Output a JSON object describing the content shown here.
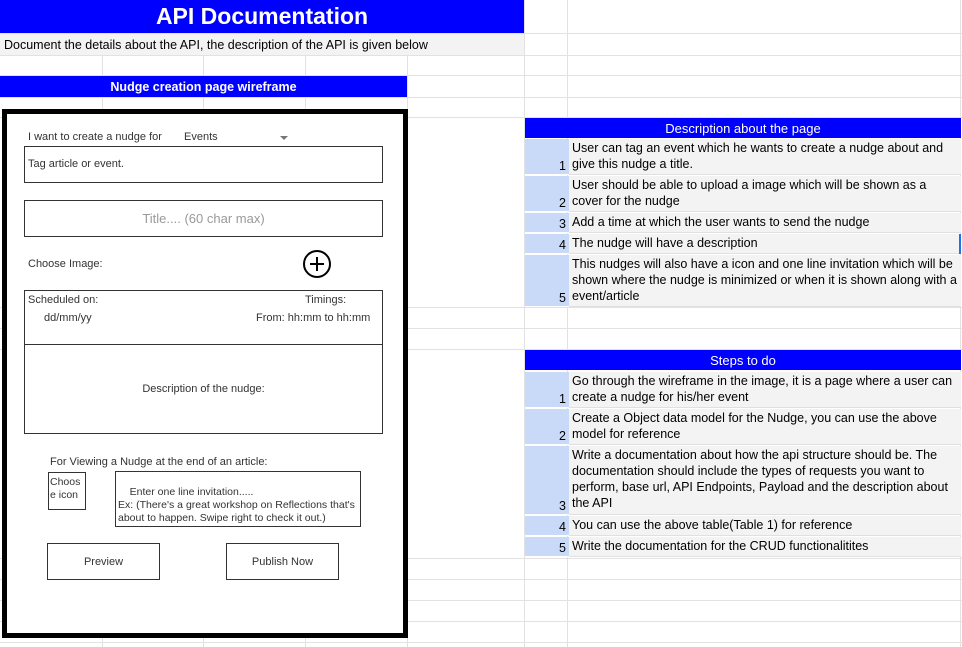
{
  "title": "API Documentation",
  "subtitle": "Document the details about the API, the description of the API is given below",
  "wireframe": {
    "header": "Nudge creation page wireframe",
    "create_label": "I want to create a nudge for",
    "select_value": "Events",
    "tag_placeholder": "Tag article or event.",
    "title_placeholder": "Title.... (60 char max)",
    "choose_image_label": "Choose Image:",
    "scheduled_label": "Scheduled on:",
    "date_placeholder": "dd/mm/yy",
    "timings_label": "Timings:",
    "time_range": "From: hh:mm to hh:mm",
    "description_label": "Description of the nudge:",
    "viewing_label": "For Viewing a Nudge at the end of an article:",
    "choose_icon_label": "Choos e icon",
    "invitation_text": "Enter one line invitation.....\nEx: (There's a great workshop on Reflections that's about to happen. Swipe right to check it out.)",
    "preview_button": "Preview",
    "publish_button": "Publish Now"
  },
  "description_table": {
    "header": "Description about the page",
    "rows": [
      {
        "num": "1",
        "text": "User can tag an event which he wants to create a nudge about and give this nudge a title."
      },
      {
        "num": "2",
        "text": "User should be able to upload a image which will be shown as a cover for the nudge"
      },
      {
        "num": "3",
        "text": "Add a time at which the user wants to send the nudge"
      },
      {
        "num": "4",
        "text": "The nudge will have a description"
      },
      {
        "num": "5",
        "text": "This nudges will also have a icon and one line invitation which will be shown where the nudge is minimized or when it is shown along with a event/article"
      }
    ]
  },
  "steps_table": {
    "header": "Steps to do",
    "rows": [
      {
        "num": "1",
        "text": "Go through the wireframe in the image, it is a page where a user can create a nudge for his/her event"
      },
      {
        "num": "2",
        "text": "Create a Object data model for the Nudge, you can use the above model for reference"
      },
      {
        "num": "3",
        "text": "Write a documentation about how the api structure should be. The documentation should include the types of requests you want to perform, base url, API Endpoints, Payload and the description about the API"
      },
      {
        "num": "4",
        "text": "You can use the above table(Table 1) for reference"
      },
      {
        "num": "5",
        "text": "Write the documentation for the CRUD functionalitites"
      }
    ]
  },
  "colors": {
    "header_blue": "#0000ff",
    "number_cell": "#c9daf8",
    "row_bg": "#f3f3f3"
  }
}
